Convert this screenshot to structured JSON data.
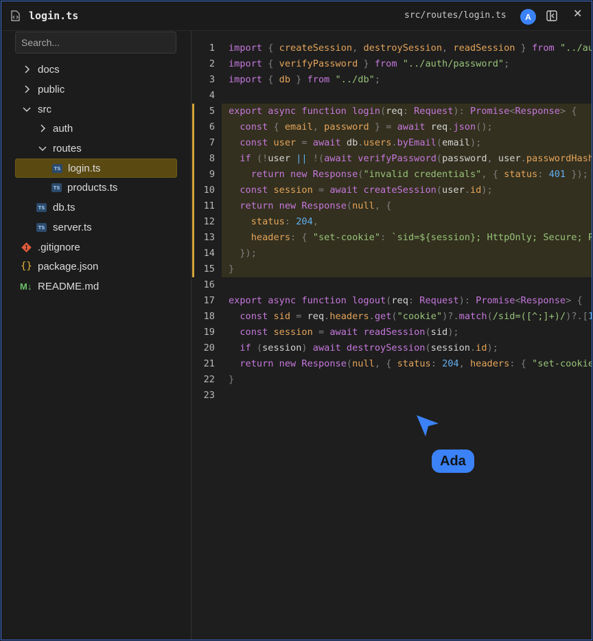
{
  "titlebar": {
    "title": "login.ts",
    "path": "src/routes/login.ts",
    "avatar_initial": "A",
    "close_glyph": "✕"
  },
  "sidebar": {
    "search_placeholder": "Search...",
    "items": [
      {
        "label": "docs",
        "type": "folder",
        "expanded": false,
        "depth": 0
      },
      {
        "label": "public",
        "type": "folder",
        "expanded": false,
        "depth": 0
      },
      {
        "label": "src",
        "type": "folder",
        "expanded": true,
        "depth": 0
      },
      {
        "label": "auth",
        "type": "folder",
        "expanded": false,
        "depth": 1
      },
      {
        "label": "routes",
        "type": "folder",
        "expanded": true,
        "depth": 1
      },
      {
        "label": "login.ts",
        "type": "ts-file",
        "depth": 2,
        "selected": true
      },
      {
        "label": "products.ts",
        "type": "ts-file",
        "depth": 2
      },
      {
        "label": "db.ts",
        "type": "ts-file",
        "depth": 1
      },
      {
        "label": "server.ts",
        "type": "ts-file",
        "depth": 1
      },
      {
        "label": ".gitignore",
        "type": "git-file",
        "depth": 0
      },
      {
        "label": "package.json",
        "type": "json-file",
        "depth": 0
      },
      {
        "label": "README.md",
        "type": "markdown-file",
        "depth": 0
      }
    ],
    "ts_badge": "TS",
    "json_glyph": "{}",
    "md_glyph": "M↓"
  },
  "editor": {
    "highlighted_lines": "5-15",
    "lines": [
      "1",
      "2",
      "3",
      "4",
      "5",
      "6",
      "7",
      "8",
      "9",
      "10",
      "11",
      "12",
      "13",
      "14",
      "15",
      "16",
      "17",
      "18",
      "19",
      "20",
      "21",
      "22",
      "23"
    ]
  },
  "cursor": {
    "label": "Ada",
    "color": "#3b82f6"
  },
  "colors": {
    "accent": "#3b82f6",
    "selection": "#5a4a12",
    "highlight_bar": "#d4a437"
  }
}
